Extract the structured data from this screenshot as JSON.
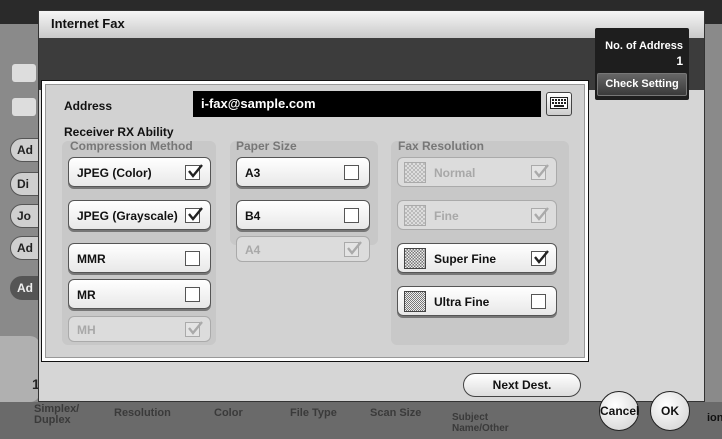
{
  "dialog": {
    "title": "Internet Fax",
    "address_count_label": "No. of Address",
    "address_count": "1",
    "check_setting_label": "Check Setting"
  },
  "address": {
    "label": "Address",
    "value": "i-fax@sample.com"
  },
  "rx_ability": {
    "label": "Receiver RX Ability",
    "compression": {
      "title": "Compression Method",
      "options": [
        {
          "label": "JPEG (Color)",
          "checked": true,
          "enabled": true
        },
        {
          "label": "JPEG (Grayscale)",
          "checked": true,
          "enabled": true
        },
        {
          "label": "MMR",
          "checked": false,
          "enabled": true
        },
        {
          "label": "MR",
          "checked": false,
          "enabled": true
        },
        {
          "label": "MH",
          "checked": true,
          "enabled": false
        }
      ]
    },
    "paper_size": {
      "title": "Paper Size",
      "options": [
        {
          "label": "A3",
          "checked": false,
          "enabled": true
        },
        {
          "label": "B4",
          "checked": false,
          "enabled": true
        },
        {
          "label": "A4",
          "checked": true,
          "enabled": false
        }
      ]
    },
    "fax_resolution": {
      "title": "Fax Resolution",
      "options": [
        {
          "label": "Normal",
          "checked": true,
          "enabled": false
        },
        {
          "label": "Fine",
          "checked": true,
          "enabled": false
        },
        {
          "label": "Super Fine",
          "checked": true,
          "enabled": true
        },
        {
          "label": "Ultra Fine",
          "checked": false,
          "enabled": true
        }
      ]
    }
  },
  "footer": {
    "next_dest_label": "Next Dest.",
    "cancel_label": "Cancel",
    "ok_label": "OK"
  },
  "background": {
    "side_buttons": [
      "Ad",
      "Di",
      "Jo",
      "Ad",
      "Ad"
    ],
    "bottom_number": "1",
    "bottom_tabs": [
      "Simplex/\nDuplex",
      "Resolution",
      "Color",
      "File Type",
      "Scan Size",
      "Subject\nName/Other"
    ],
    "right_partial": "ion"
  }
}
